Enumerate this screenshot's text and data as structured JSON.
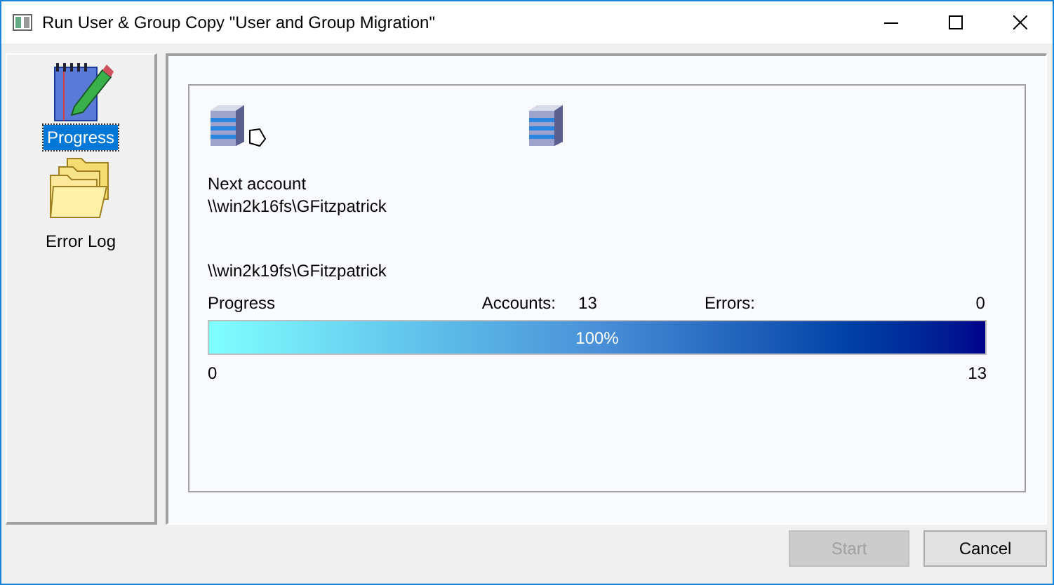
{
  "window": {
    "title": "Run User & Group Copy \"User and Group Migration\""
  },
  "sidebar": {
    "items": [
      {
        "kind": "notepad",
        "label": "Progress",
        "selected": true
      },
      {
        "kind": "folders",
        "label": "Error Log",
        "selected": false
      }
    ]
  },
  "progress": {
    "caption": "Next account",
    "source": "\\\\win2k16fs\\GFitzpatrick",
    "target": "\\\\win2k19fs\\GFitzpatrick",
    "label": "Progress",
    "accounts_label": "Accounts:",
    "accounts": "13",
    "errors_label": "Errors:",
    "errors": "0",
    "level": 1,
    "percent": "100%",
    "min": "0",
    "max": "13"
  },
  "buttons": [
    {
      "label": "Start",
      "disabled": true
    },
    {
      "label": "Cancel",
      "disabled": false
    }
  ]
}
